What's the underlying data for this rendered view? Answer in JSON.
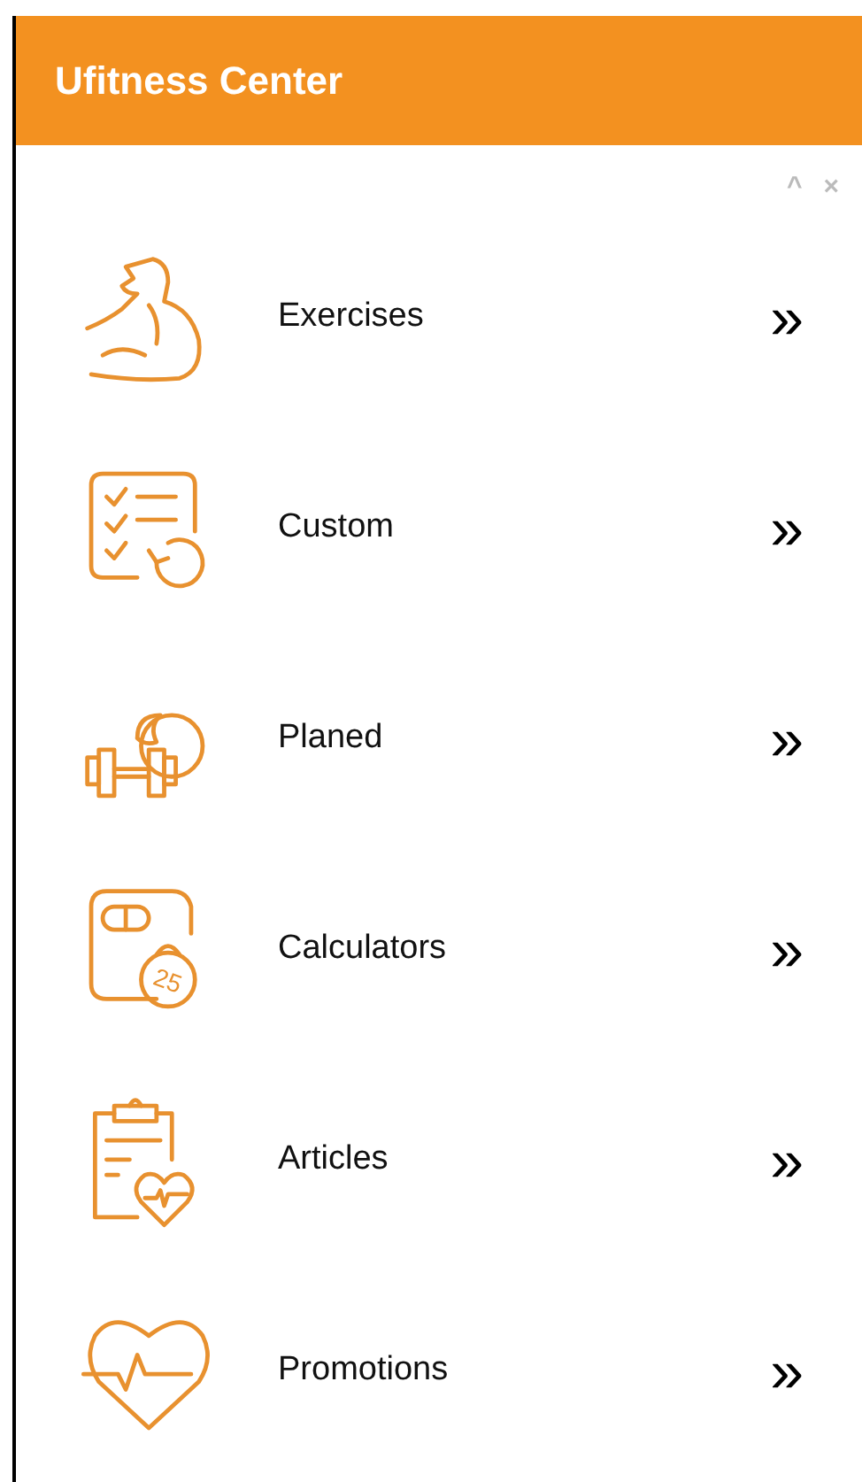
{
  "header": {
    "title": "Ufitness Center"
  },
  "panel_controls": {
    "collapse": "^",
    "close": "×"
  },
  "menu": [
    {
      "kind": "muscle",
      "label": "Exercises",
      "chevron": "»"
    },
    {
      "kind": "checklist",
      "label": "Custom",
      "chevron": "»"
    },
    {
      "kind": "dumbbell",
      "label": "Planed",
      "chevron": "»"
    },
    {
      "kind": "scale",
      "label": "Calculators",
      "chevron": "»",
      "icon_text": "25"
    },
    {
      "kind": "clipboard",
      "label": "Articles",
      "chevron": "»"
    },
    {
      "kind": "heart",
      "label": "Promotions",
      "chevron": "»"
    }
  ]
}
